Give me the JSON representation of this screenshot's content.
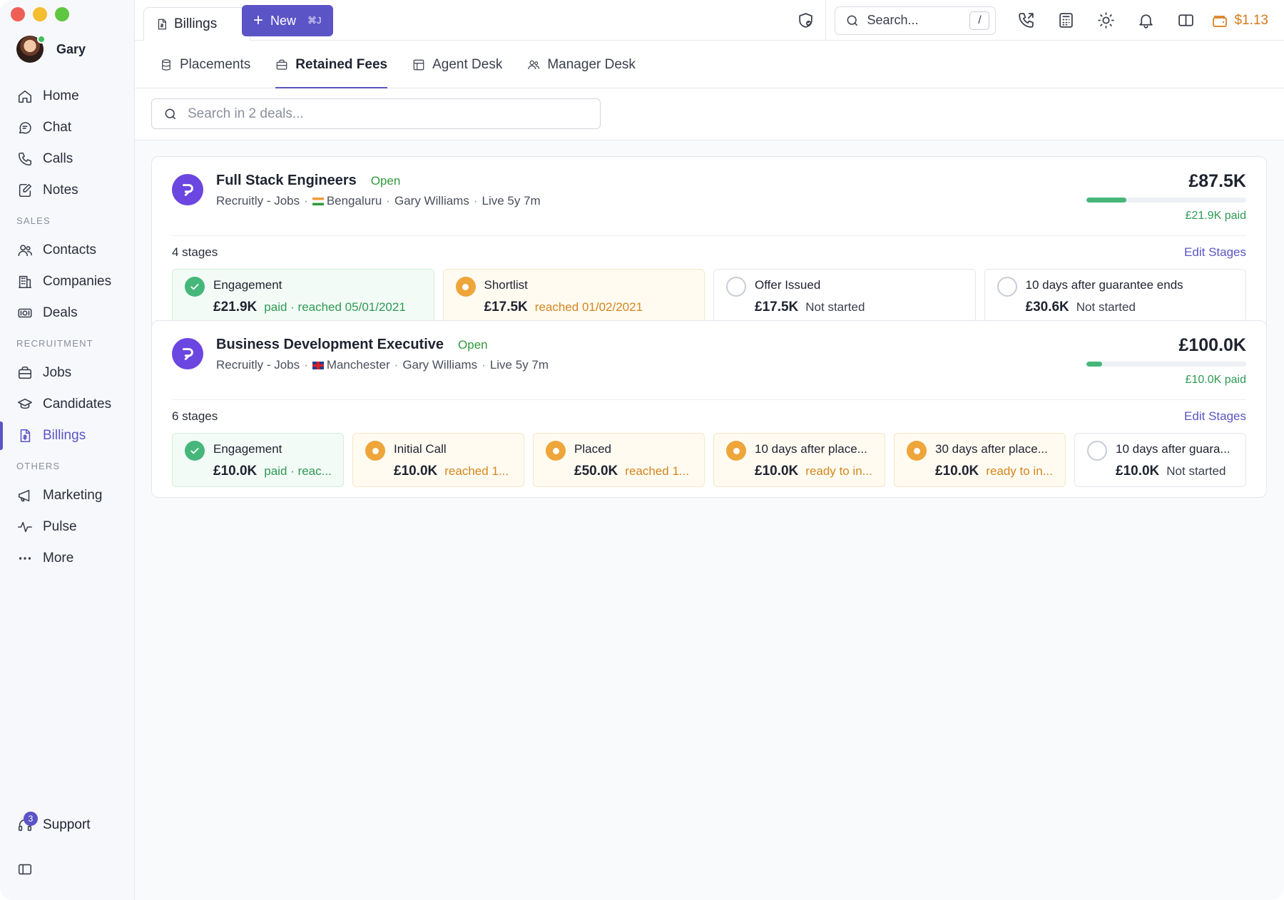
{
  "user": {
    "name": "Gary"
  },
  "nav": {
    "home": "Home",
    "chat": "Chat",
    "calls": "Calls",
    "notes": "Notes",
    "sales_section": "SALES",
    "contacts": "Contacts",
    "companies": "Companies",
    "deals": "Deals",
    "recruitment_section": "RECRUITMENT",
    "jobs": "Jobs",
    "candidates": "Candidates",
    "billings": "Billings",
    "others_section": "OTHERS",
    "marketing": "Marketing",
    "pulse": "Pulse",
    "more": "More"
  },
  "support": {
    "label": "Support",
    "badge": "3"
  },
  "topbar": {
    "tab_label": "Billings",
    "new_label": "New",
    "new_shortcut": "⌘J",
    "search_placeholder": "Search...",
    "search_shortcut": "/",
    "credit": "$1.13"
  },
  "subtabs": [
    "Placements",
    "Retained Fees",
    "Agent Desk",
    "Manager Desk"
  ],
  "deal_search": {
    "placeholder": "Search in 2 deals..."
  },
  "colors": {
    "accent": "#5b54c6",
    "success": "#2f9a55",
    "warning": "#eea53a",
    "brand_logo": "#6b46e0"
  },
  "deals": [
    {
      "title": "Full Stack Engineers",
      "status": "Open",
      "company": "Recruitly - Jobs",
      "location": "Bengaluru",
      "owner": "Gary Williams",
      "live": "Live 5y 7m",
      "amount": "£87.5K",
      "paid": "£21.9K paid",
      "paid_fraction": 0.25,
      "stages_count": "4 stages",
      "edit_label": "Edit Stages",
      "stages": [
        {
          "name": "Engagement",
          "amount": "£21.9K",
          "status": "paid · reached 05/01/2021",
          "state": "paid"
        },
        {
          "name": "Shortlist",
          "amount": "£17.5K",
          "status": "reached 01/02/2021",
          "state": "reached"
        },
        {
          "name": "Offer Issued",
          "amount": "£17.5K",
          "status": "Not started",
          "state": "empty"
        },
        {
          "name": "10 days after guarantee ends",
          "amount": "£30.6K",
          "status": "Not started",
          "state": "empty"
        }
      ]
    },
    {
      "title": "Business Development Executive",
      "status": "Open",
      "company": "Recruitly - Jobs",
      "location": "Manchester",
      "owner": "Gary Williams",
      "live": "Live 5y 7m",
      "amount": "£100.0K",
      "paid": "£10.0K paid",
      "paid_fraction": 0.1,
      "stages_count": "6 stages",
      "edit_label": "Edit Stages",
      "stages": [
        {
          "name": "Engagement",
          "amount": "£10.0K",
          "status": "paid · reac...",
          "state": "paid"
        },
        {
          "name": "Initial Call",
          "amount": "£10.0K",
          "status": "reached 1...",
          "state": "reached"
        },
        {
          "name": "Placed",
          "amount": "£50.0K",
          "status": "reached 1...",
          "state": "reached"
        },
        {
          "name": "10 days after place...",
          "amount": "£10.0K",
          "status": "ready to in...",
          "state": "reached"
        },
        {
          "name": "30 days after place...",
          "amount": "£10.0K",
          "status": "ready to in...",
          "state": "reached"
        },
        {
          "name": "10 days after guara...",
          "amount": "£10.0K",
          "status": "Not started",
          "state": "empty"
        }
      ]
    }
  ]
}
